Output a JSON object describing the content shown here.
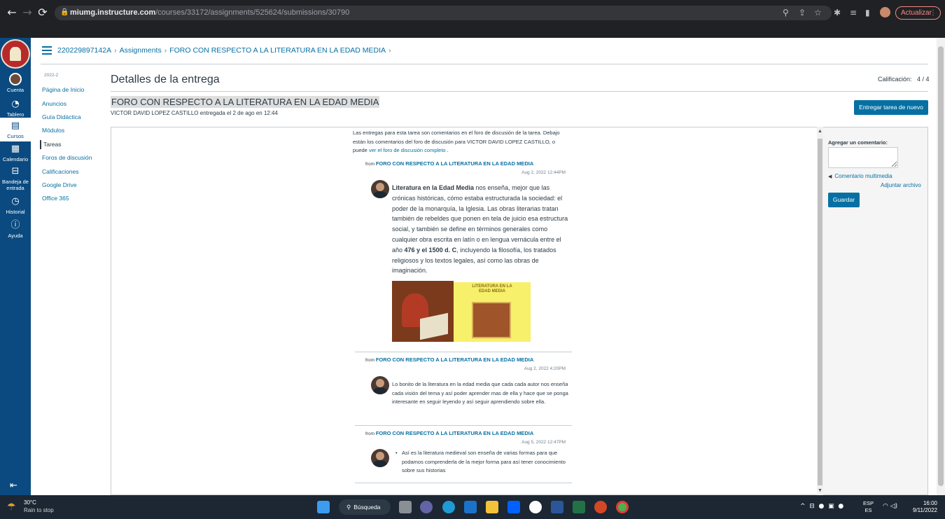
{
  "browser": {
    "url_host": "miumg.instructure.com",
    "url_path": "/courses/33172/assignments/525624/submissions/30790",
    "update_label": "Actualizar"
  },
  "global_nav": {
    "items": [
      {
        "label": "Cuenta",
        "icon": "avatar"
      },
      {
        "label": "Tablero",
        "icon": "dashboard-icon"
      },
      {
        "label": "Cursos",
        "icon": "courses-icon"
      },
      {
        "label": "Calendario",
        "icon": "calendar-icon"
      },
      {
        "label": "Bandeja de entrada",
        "icon": "inbox-icon"
      },
      {
        "label": "Historial",
        "icon": "history-icon"
      },
      {
        "label": "Ayuda",
        "icon": "help-icon"
      }
    ]
  },
  "breadcrumb": {
    "course": "220229897142A",
    "section": "Assignments",
    "assignment": "FORO CON RESPECTO A LA LITERATURA EN LA EDAD MEDIA"
  },
  "course_nav": {
    "term": "2022-2",
    "items": [
      "Página de Inicio",
      "Anuncios",
      "Guía Didáctica",
      "Módulos",
      "Tareas",
      "Foros de discusión",
      "Calificaciones",
      "Google Drive",
      "Office 365"
    ],
    "active_index": 4
  },
  "main": {
    "title": "Detalles de la entrega",
    "grade_label": "Calificación:",
    "grade_value": "4 / 4",
    "assignment_title": "FORO CON RESPECTO A LA LITERATURA EN LA EDAD MEDIA",
    "submitter": "VICTOR DAVID LOPEZ CASTILLO",
    "submitted_text": "entregada el 2 de ago en 12:44",
    "resubmit_label": "Entregar tarea de nuevo"
  },
  "submission": {
    "intro_text": "Las entregas para esta tarea son comentarios en el foro de discusión de la tarea. Debajo están los comentarios del foro de discusión para VICTOR DAVID LOPEZ CASTILLO, o puede",
    "intro_link": "ver el foro de discusión completo",
    "from_label": "from",
    "forum_link": "FORO CON RESPECTO A LA LITERATURA EN LA EDAD MEDIA",
    "posts": [
      {
        "date": "Aug 2, 2022 12:44PM",
        "bold_lead": "Literatura en la Edad Media",
        "text_a": " nos enseña, mejor que las crónicas históricas, cómo estaba estructurada la sociedad: el poder de la monarquía, la Iglesia. Las obras literarias tratan también de rebeldes que ponen en tela de juicio esa estructura social, y también se define en términos generales como cualquier obra escrita en latín o en lengua vernácula entre el año ",
        "bold_mid": "476 y el 1500 d. C",
        "text_b": ", incluyendo la filosofía, los tratados religiosos y los textos legales, así como las obras de imaginación.",
        "image_caption": "LITERATURA EN LA EDAD MEDIA"
      },
      {
        "date": "Aug 2, 2022 4:20PM",
        "text": "Lo bonito de la literatura en la edad media que cada cada autor nos enseña cada visión del tema y así poder aprender mas de ella y hace que se ponga interesante en seguir leyendo y así seguir aprendiendo sobre ella."
      },
      {
        "date": "Aug 5, 2022 12:47PM",
        "text": "Así es la literatura medieval son enseña de varias formas para que podamos comprenderla de la mejor forma para así tener conocimiento sobre sus historias"
      }
    ]
  },
  "comment_panel": {
    "label": "Agregar un comentario:",
    "media_label": "Comentario multimedia",
    "attach_label": "Adjuntar archivo",
    "save_label": "Guardar"
  },
  "taskbar": {
    "temperature": "30°C",
    "weather_status": "Rain to stop",
    "search_label": "Búsqueda",
    "lang_top": "ESP",
    "lang_bottom": "ES",
    "time": "16:00",
    "date": "9/11/2022"
  },
  "colors": {
    "brand_nav": "#0a4a80",
    "link": "#0770a3",
    "button": "#0770a3"
  }
}
